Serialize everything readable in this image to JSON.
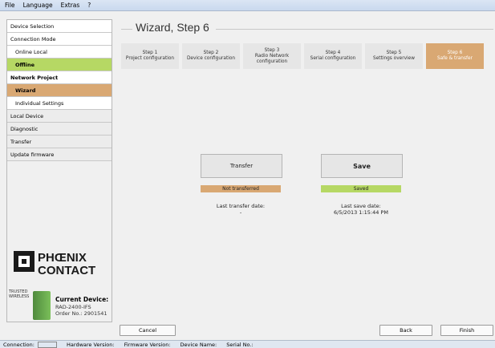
{
  "menu": [
    "File",
    "Language",
    "Extras",
    "?"
  ],
  "sidebar": {
    "items": [
      {
        "label": "Device Selection",
        "style": "plain"
      },
      {
        "label": "Connection Mode",
        "style": "plain"
      },
      {
        "label": "Online Local",
        "style": "indent"
      },
      {
        "label": "Offline",
        "style": "green"
      },
      {
        "label": "Network Project",
        "style": "head"
      },
      {
        "label": "Wizard",
        "style": "orange"
      },
      {
        "label": "Individual Settings",
        "style": "indent"
      },
      {
        "label": "Local Device",
        "style": "gray"
      },
      {
        "label": "Diagnostic",
        "style": "gray"
      },
      {
        "label": "Transfer",
        "style": "gray"
      },
      {
        "label": "Update firmware",
        "style": "gray"
      }
    ]
  },
  "logo": {
    "line1": "PHŒNIX",
    "line2": "CONTACT"
  },
  "device": {
    "trusted": "TRUSTED WIRELESS",
    "title": "Current Device:",
    "model": "RAD-2400-IFS",
    "order": "Order No.: 2901541"
  },
  "main": {
    "title": "Wizard, Step 6",
    "steps": [
      {
        "l1": "Step 1",
        "l2": "Project configuration",
        "l3": ""
      },
      {
        "l1": "Step 2",
        "l2": "Device configuration",
        "l3": ""
      },
      {
        "l1": "Step 3",
        "l2": "Radio Network",
        "l3": "configuration"
      },
      {
        "l1": "Step 4",
        "l2": "Serial configuration",
        "l3": ""
      },
      {
        "l1": "Step 5",
        "l2": "Settings overview",
        "l3": ""
      },
      {
        "l1": "Step 6",
        "l2": "Safe & transfer",
        "l3": ""
      }
    ],
    "transfer_label": "Transfer",
    "save_label": "Save",
    "transfer_status": "Not transferred",
    "save_status": "Saved",
    "last_transfer_label": "Last transfer date:",
    "last_transfer_value": "-",
    "last_save_label": "Last save date:",
    "last_save_value": "6/5/2013 1:15:44 PM"
  },
  "footer": {
    "cancel": "Cancel",
    "back": "Back",
    "finish": "Finish"
  },
  "statusbar": {
    "connection": "Connection:",
    "hardware": "Hardware Version:",
    "firmware": "Firmware Version:",
    "device_name": "Device Name:",
    "serial": "Serial No.:"
  },
  "colors": {
    "green": "#b6d864",
    "orange": "#d9a873"
  }
}
